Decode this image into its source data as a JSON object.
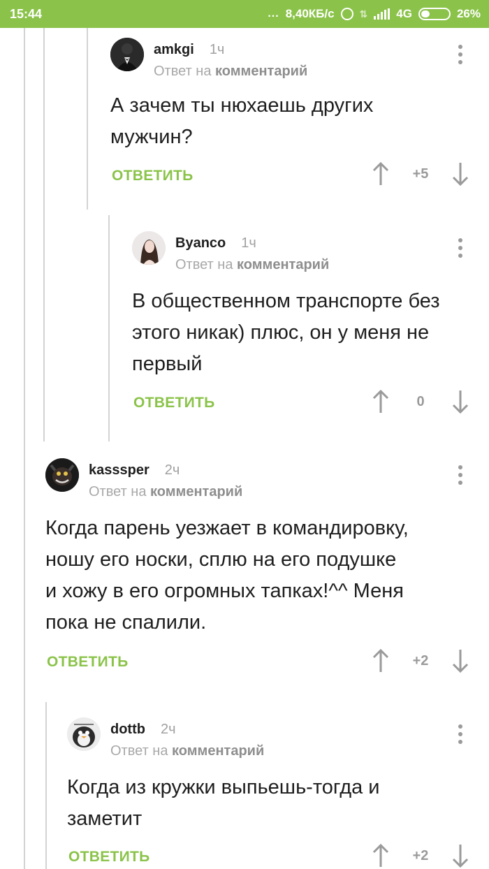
{
  "status_bar": {
    "time": "15:44",
    "dots": "...",
    "speed": "8,40КБ/с",
    "network": "4G",
    "battery": "26%"
  },
  "labels": {
    "reply_prefix": "Ответ на",
    "reply_link": "комментарий",
    "reply_button": "ОТВЕТИТЬ"
  },
  "comments": [
    {
      "author": "amkgi",
      "time": "1ч",
      "text_lines": [
        "А зачем ты нюхаешь других",
        "мужчин?"
      ],
      "score": "+5"
    },
    {
      "author": "Byanco",
      "time": "1ч",
      "text_lines": [
        "В общественном транспорте без",
        "этого никак) плюс, он у меня не",
        "первый"
      ],
      "score": "0"
    },
    {
      "author": "kasssper",
      "time": "2ч",
      "text_lines": [
        "Когда парень уезжает в командировку,",
        "ношу его носки, сплю на его подушке",
        "и хожу в его огромных тапках!^^ Меня",
        "пока не спалили."
      ],
      "score": "+2"
    },
    {
      "author": "dottb",
      "time": "2ч",
      "text_lines": [
        "Когда из кружки выпьешь-тогда и",
        "заметит"
      ],
      "score": "+2"
    }
  ],
  "colors": {
    "accent": "#8bc34a",
    "muted": "#a0a0a0",
    "text": "#1e1e1e",
    "thread_line": "#d3d3d3"
  }
}
